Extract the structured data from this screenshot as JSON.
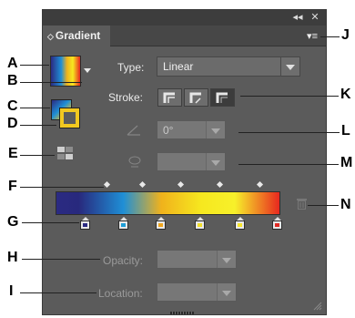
{
  "panel": {
    "title": "Gradient",
    "title_arrows": "◇",
    "topbar": {
      "collapse_glyph": "◂◂",
      "close_glyph": "✕"
    },
    "menu_glyph": "▾≡"
  },
  "controls": {
    "type_label": "Type:",
    "type_value": "Linear",
    "stroke_label": "Stroke:",
    "angle_value": "0°",
    "aspect_value": "",
    "opacity_label": "Opacity:",
    "opacity_value": "",
    "location_label": "Location:",
    "location_value": ""
  },
  "gradient": {
    "stop_colors": [
      "#2b2a82",
      "#1f9fd8",
      "#f0a51c",
      "#f2df2a",
      "#f8e62b",
      "#e02a24"
    ]
  },
  "callouts": [
    "A",
    "B",
    "C",
    "D",
    "E",
    "F",
    "G",
    "H",
    "I",
    "J",
    "K",
    "L",
    "M",
    "N"
  ]
}
